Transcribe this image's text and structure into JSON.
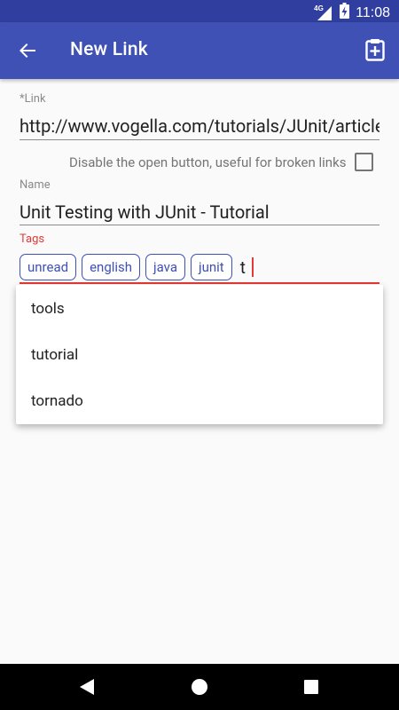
{
  "status_bar": {
    "network_type": "4G",
    "time": "11:08"
  },
  "app_bar": {
    "title": "New Link"
  },
  "link": {
    "label": "*Link",
    "value": "http://www.vogella.com/tutorials/JUnit/article.html"
  },
  "disable_option": {
    "label": "Disable the open button, useful for broken links",
    "checked": false
  },
  "name": {
    "label": "Name",
    "value": "Unit Testing with JUnit - Tutorial"
  },
  "tags": {
    "label": "Tags",
    "chips": [
      "unread",
      "english",
      "java",
      "junit"
    ],
    "typed": "t",
    "suggestions": [
      "tools",
      "tutorial",
      "tornado"
    ]
  },
  "colors": {
    "primary": "#3f51b5",
    "primary_dark": "#303f9f",
    "accent": "#e53935"
  },
  "icons": {
    "back": "arrow-back-icon",
    "paste": "clipboard-plus-icon",
    "signal": "signal-icon",
    "battery": "battery-charging-icon",
    "nav_back": "triangle-back-icon",
    "nav_home": "circle-home-icon",
    "nav_recents": "square-recents-icon"
  }
}
